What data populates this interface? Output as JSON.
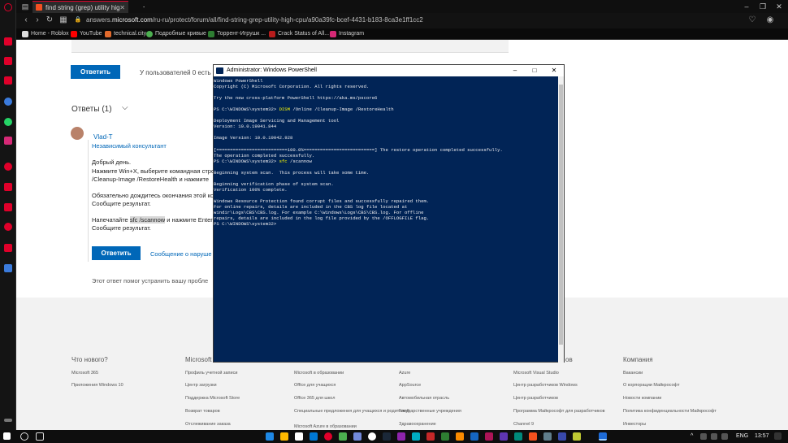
{
  "browser": {
    "tabs": [
      {
        "label": "find string (grep) utility hig",
        "active": true
      },
      {
        "label": "",
        "active": false
      }
    ],
    "new_tab": "+",
    "url_prefix": "answers.",
    "url_host": "microsoft.com",
    "url_rest": "/ru-ru/protect/forum/all/find-string-grep-utility-high-cpu/a90a39fc-bcef-4431-b183-8ca3e1ff1cc2",
    "bookmarks": [
      "Home - Roblox",
      "YouTube",
      "technical.city",
      "Подробные кривые ...",
      "Торрент-Игрушк ...",
      "Crack Status of All...",
      "Instagram"
    ],
    "colors": {
      "accent": "#e0002a",
      "chrome": "#0f0f0f"
    }
  },
  "page": {
    "reply_button_top": "Ответить",
    "helpful_text": "У пользователей 0 есть та",
    "answers_heading": "Ответы (1)",
    "user_name": "Vlad-T",
    "user_role": "Независимый консультант",
    "greeting": "Добрый день.",
    "instruction_line1": "Нажмите Win+X, выберите командная стро",
    "instruction_line2": "/Cleanup-Image /RestoreHealth и нажмите",
    "wait_line1": "Обязательно дождитесь окончания этой ко",
    "wait_line2": "Сообщите результат.",
    "type_prefix": "Напечатайте ",
    "type_cmd": "sfc /scannow",
    "type_suffix": " и нажмите Enter",
    "report": "Сообщите результат.",
    "reply_button": "Ответить",
    "report_abuse": "Сообщение о наруше",
    "helped_text": "Этот ответ помог устранить вашу пробле",
    "colors": {
      "primary": "#0067b8"
    }
  },
  "footer": {
    "columns": [
      {
        "heading": "Что нового?",
        "links": [
          "Microsoft 365",
          "Приложения Windows 10",
          "",
          "",
          ""
        ]
      },
      {
        "heading": "Microsoft",
        "links": [
          "Профиль учетной записи",
          "Центр загрузки",
          "Поддержка Microsoft Store",
          "Возврат товаров",
          "Отслеживание заказа"
        ]
      },
      {
        "heading": "",
        "links": [
          "Microsoft в образовании",
          "Office для учащихся",
          "Office 365 для школ",
          "Специальные предложения для учащихся и родителей",
          "Microsoft Azure в образовании"
        ]
      },
      {
        "heading": "",
        "links": [
          "Azure",
          "AppSource",
          "Автомобильная отрасль",
          "Государственные учреждения",
          "Здравоохранение"
        ]
      },
      {
        "heading": "ов",
        "links": [
          "Microsoft Visual Studio",
          "Центр разработчиков Windows",
          "Центр разработчиков",
          "Программа Майкрософт для разработчиков",
          "Channel 9"
        ]
      },
      {
        "heading": "Компания",
        "links": [
          "Вакансии",
          "О корпорации Майкрософт",
          "Новости компании",
          "Политика конфиденциальности Майкрософт",
          "Инвесторы"
        ]
      }
    ]
  },
  "powershell": {
    "title": "Administrator: Windows PowerShell",
    "lines": [
      {
        "text": "Windows PowerShell"
      },
      {
        "text": "Copyright (C) Microsoft Corporation. All rights reserved."
      },
      {
        "text": ""
      },
      {
        "text": "Try the new cross-platform PowerShell https://aka.ms/pscore6"
      },
      {
        "text": ""
      },
      {
        "text": "PS C:\\WINDOWS\\system32> ",
        "cmd": "DISM",
        "rest": " /Online /Cleanup-Image /RestoreHealth"
      },
      {
        "text": ""
      },
      {
        "text": "Deployment Image Servicing and Management tool"
      },
      {
        "text": "Version: 10.0.19041.844"
      },
      {
        "text": ""
      },
      {
        "text": "Image Version: 10.0.19042.928"
      },
      {
        "text": ""
      },
      {
        "text": "[==========================100.0%==========================] The restore operation completed successfully."
      },
      {
        "text": "The operation completed successfully."
      },
      {
        "text": "PS C:\\WINDOWS\\system32> ",
        "cmd": "sfc",
        "rest": " /scannow"
      },
      {
        "text": ""
      },
      {
        "text": "Beginning system scan.  This process will take some time."
      },
      {
        "text": ""
      },
      {
        "text": "Beginning verification phase of system scan."
      },
      {
        "text": "Verification 100% complete."
      },
      {
        "text": ""
      },
      {
        "text": "Windows Resource Protection found corrupt files and successfully repaired them."
      },
      {
        "text": "For online repairs, details are included in the CBS log file located at"
      },
      {
        "text": "windir\\Logs\\CBS\\CBS.log. For example C:\\Windows\\Logs\\CBS\\CBS.log. For offline"
      },
      {
        "text": "repairs, details are included in the log file provided by the /OFFLOGFILE flag."
      },
      {
        "text": "PS C:\\WINDOWS\\system32>"
      }
    ],
    "colors": {
      "background": "#012456",
      "text": "#eeedf0",
      "command": "#ffff00"
    }
  },
  "taskbar": {
    "language": "ENG",
    "time": "13:57"
  }
}
